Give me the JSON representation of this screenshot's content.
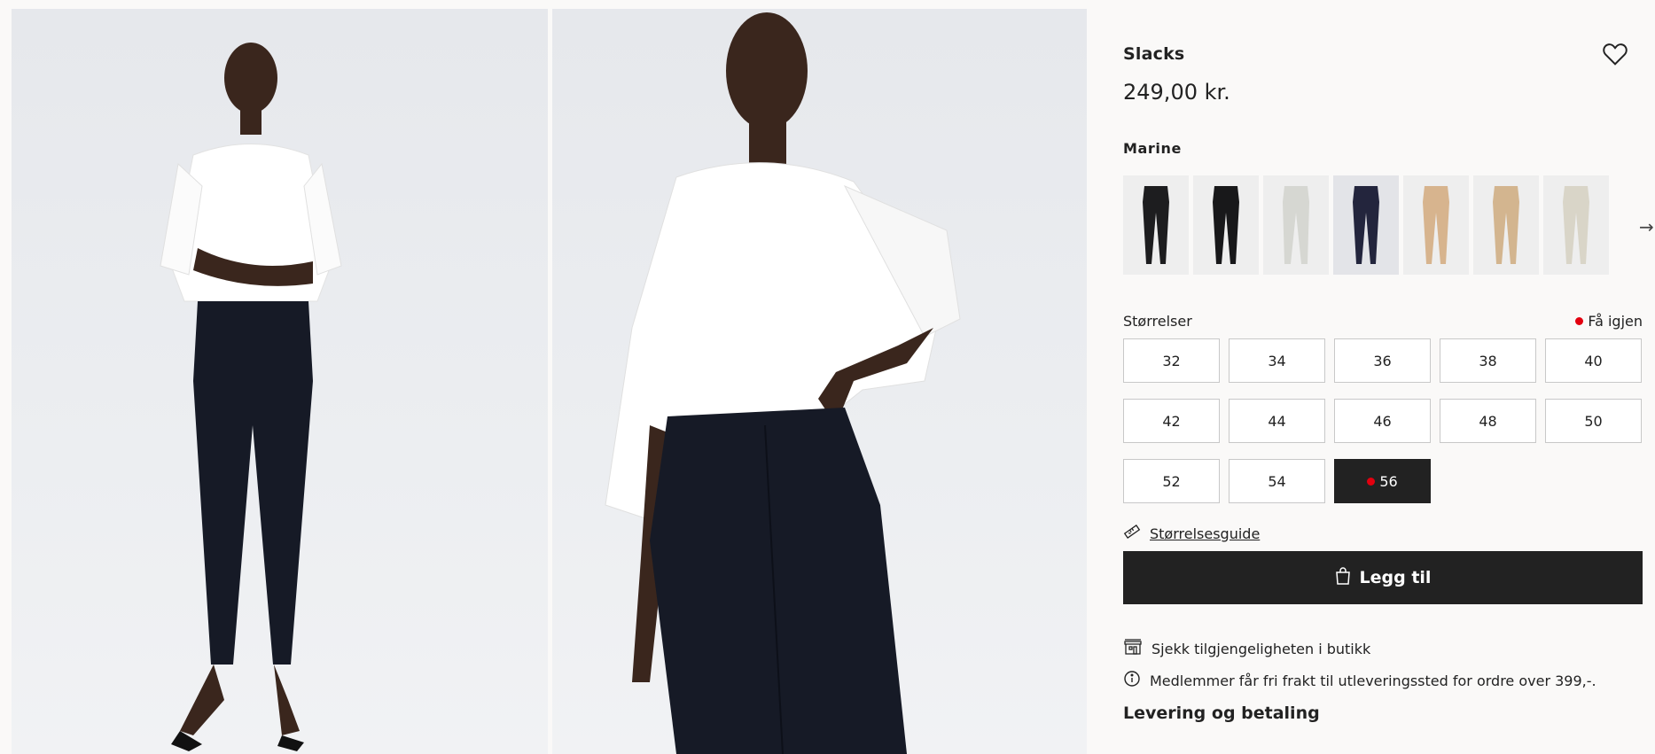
{
  "product": {
    "title": "Slacks",
    "price": "249,00 kr.",
    "color_name": "Marine"
  },
  "swatches": [
    {
      "name": "black-1",
      "color": "#1d1d1f"
    },
    {
      "name": "black-2",
      "color": "#18181a"
    },
    {
      "name": "light-grey",
      "color": "#d6d7d2"
    },
    {
      "name": "navy",
      "color": "#23253d"
    },
    {
      "name": "beige",
      "color": "#d7b48e"
    },
    {
      "name": "beige-2",
      "color": "#d3b58f"
    },
    {
      "name": "cream",
      "color": "#d9d5c8"
    }
  ],
  "sizes": {
    "label": "Størrelser",
    "restock_label": "Få igjen",
    "options": [
      "32",
      "34",
      "36",
      "38",
      "40",
      "42",
      "44",
      "46",
      "48",
      "50",
      "52",
      "54",
      "56"
    ]
  },
  "size_guide": "Størrelsesguide",
  "add_to_cart": "Legg til",
  "store_availability": "Sjekk tilgjengeligheten i butikk",
  "member_shipping": "Medlemmer får fri frakt til utleveringssted for ordre over 399,-.",
  "delivery_heading": "Levering og betaling",
  "icons": {
    "favorite": "heart-icon",
    "next": "arrow-right-icon",
    "ruler": "ruler-icon",
    "bag": "shopping-bag-icon",
    "store": "store-icon",
    "info": "info-icon"
  },
  "colors": {
    "accent": "#222222",
    "sold_dot": "#e3000f",
    "background": "#faf9f8"
  }
}
